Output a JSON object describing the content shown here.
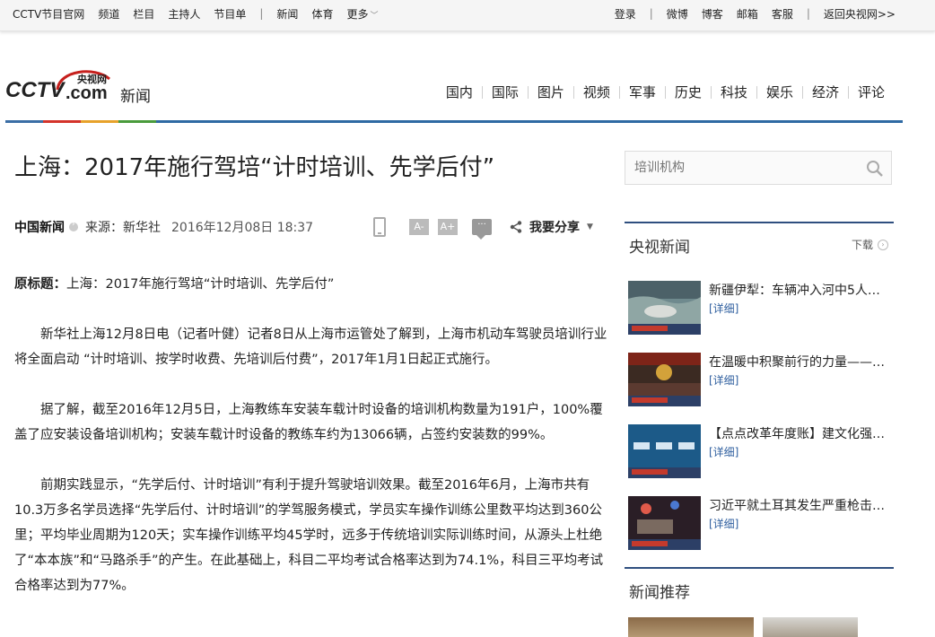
{
  "topbar": {
    "left": [
      "CCTV节目官网",
      "频道",
      "栏目",
      "主持人",
      "节目单",
      "新闻",
      "体育",
      "更多"
    ],
    "right": [
      "登录",
      "微博",
      "博客",
      "邮箱",
      "客服",
      "返回央视网>>"
    ]
  },
  "logo": {
    "brand_text": "央视网",
    "section": "新闻"
  },
  "nav": [
    "国内",
    "国际",
    "图片",
    "视频",
    "军事",
    "历史",
    "科技",
    "娱乐",
    "经济",
    "评论"
  ],
  "article": {
    "title": "上海：2017年施行驾培“计时培训、先学后付”",
    "source_name": "中国新闻",
    "from": "来源：新华社",
    "date": "2016年12月08日 18:37",
    "font_small": "A-",
    "font_large": "A+",
    "share_label": "我要分享",
    "original_title_label": "原标题：",
    "original_title": "上海：2017年施行驾培“计时培训、先学后付”",
    "paragraphs": [
      "新华社上海12月8日电（记者叶健）记者8日从上海市运管处了解到，上海市机动车驾驶员培训行业将全面启动 “计时培训、按学时收费、先培训后付费”，2017年1月1日起正式施行。",
      "据了解，截至2016年12月5日，上海教练车安装车载计时设备的培训机构数量为191户，100%覆盖了应安装设备培训机构；安装车载计时设备的教练车约为13066辆，占签约安装数的99%。",
      "前期实践显示，“先学后付、计时培训”有利于提升驾驶培训效果。截至2016年6月，上海市共有10.3万多名学员选择“先学后付、计时培训”的学驾服务模式，学员实车操作训练公里数平均达到360公里；平均毕业周期为120天；实车操作训练平均45学时，远多于传统培训实际训练时间，从源头上杜绝了“本本族”和“马路杀手”的产生。在此基础上，科目二平均考试合格率达到为74.1%，科目三平均考试合格率达到为77%。"
    ]
  },
  "sidebar": {
    "search_placeholder": "培训机构",
    "cctv_news": {
      "title": "央视新闻",
      "more": "下载",
      "items": [
        {
          "headline": "新疆伊犁：车辆冲入河中5人…",
          "detail": "[详细]"
        },
        {
          "headline": "在温暖中积聚前行的力量——…",
          "detail": "[详细]"
        },
        {
          "headline": "【点点改革年度账】建文化强…",
          "detail": "[详细]"
        },
        {
          "headline": "习近平就土耳其发生严重枪击…",
          "detail": "[详细]"
        }
      ]
    },
    "recommend": {
      "title": "新闻推荐"
    }
  },
  "colors": {
    "accent_blue": "#2f4f7f",
    "link_blue": "#2f5f9f",
    "logo_red": "#c6201d"
  }
}
